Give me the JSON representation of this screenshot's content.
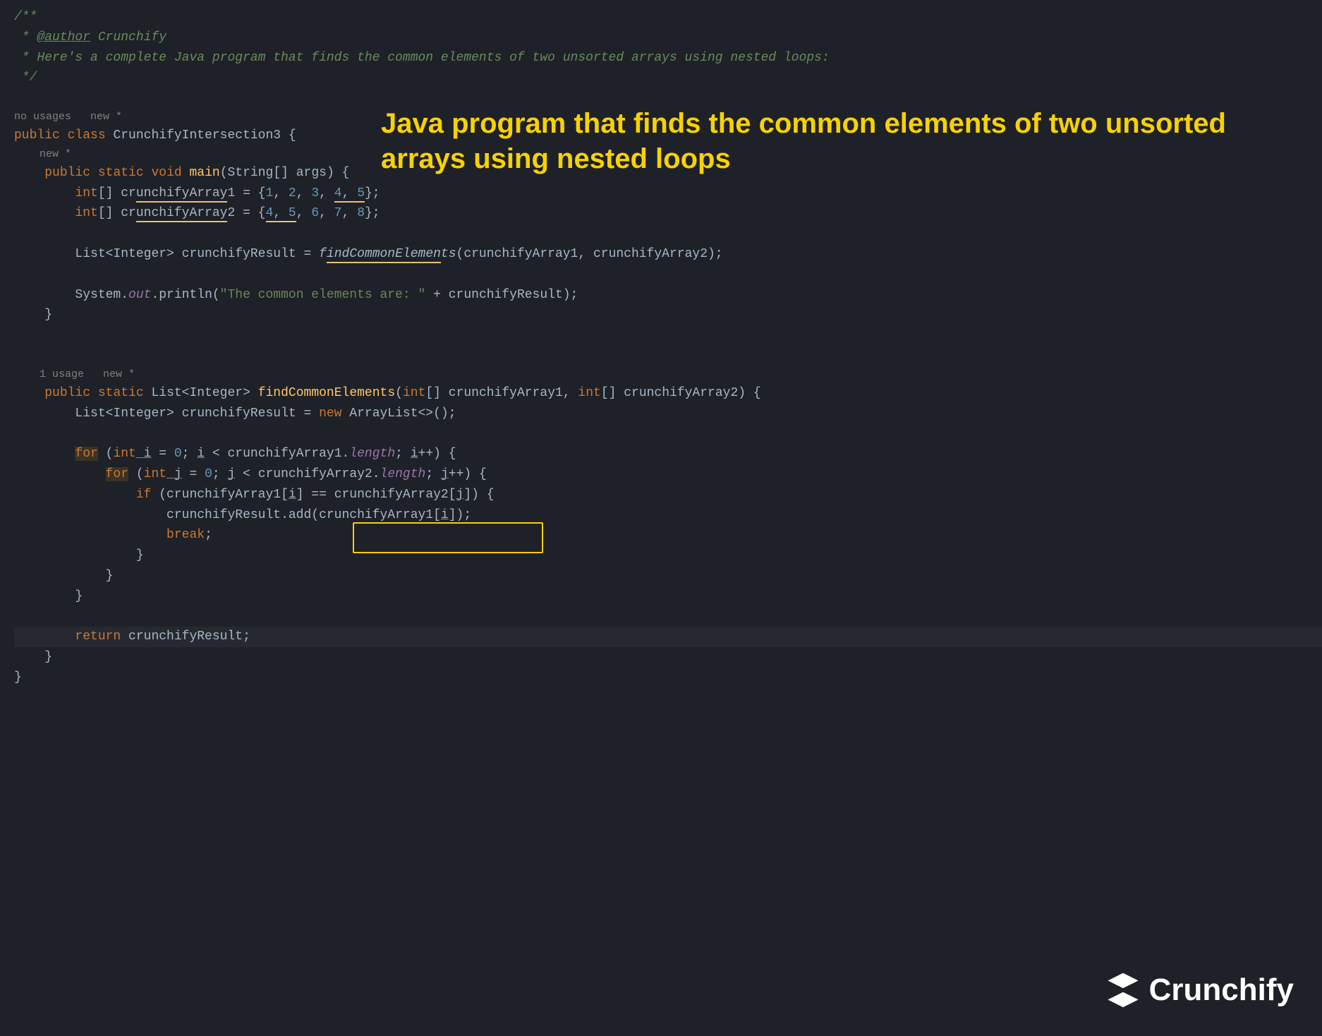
{
  "overlay_title": "Java program that finds the common elements of two unsorted arrays using nested loops",
  "logo_text": "Crunchify",
  "annotations": {
    "class": "no usages   new *",
    "main": "new *",
    "find": "1 usage   new *"
  },
  "code": {
    "c1": "/**",
    "c2_pre": " * ",
    "c2_tag": "@author",
    "c2_post": " Crunchify",
    "c3": " * Here's a complete Java program that finds the common elements of two unsorted arrays using nested loops:",
    "c4": " */",
    "k_public": "public",
    "k_class": "class",
    "class_name": "CrunchifyIntersection3",
    "k_static": "static",
    "k_void": "void",
    "m_main": "main",
    "p_main": "(String[] args) {",
    "t_int_arr": "int",
    "brackets": "[] ",
    "arr1_name": "crunchifyArray1",
    "arr1_init_pre": " = {",
    "arr1_vals_a": "1",
    "arr1_vals_b": "2",
    "arr1_vals_c": "3",
    "arr1_vals_d": "4",
    "arr1_vals_e": "5",
    "arr1_close": "};",
    "arr2_name": "crunchifyArray2",
    "arr2_vals_a": "4",
    "arr2_vals_b": "5",
    "arr2_vals_c": "6",
    "arr2_vals_d": "7",
    "arr2_vals_e": "8",
    "t_list": "List<Integer> crunchifyResult = ",
    "m_find_call": "findCommonElements",
    "call_args": "(crunchifyArray1, crunchifyArray2);",
    "sys": "System.",
    "out": "out",
    "println_pre": ".println(",
    "str_lit": "\"The common elements are: \"",
    "println_post": " + crunchifyResult);",
    "brace_close": "}",
    "ret_type": "List<Integer> ",
    "m_find": "findCommonElements",
    "find_params_pre": "(",
    "find_p1_type": "int",
    "find_p1_name": "[] crunchifyArray1, ",
    "find_p2_type": "int",
    "find_p2_name": "[] crunchifyArray2) {",
    "result_decl_pre": "List<Integer> crunchifyResult = ",
    "k_new": "new",
    "result_decl_post": " ArrayList<>();",
    "k_for": "for",
    "for1_pre": " (",
    "for1_int": "int",
    "for1_i": " i",
    "for1_eq": " = ",
    "for1_zero": "0",
    "for1_mid": "; ",
    "for1_cond_i": "i",
    "for1_cond": " < crunchifyArray1.",
    "for1_len": "length",
    "for1_inc_pre": "; ",
    "for1_inc_i": "i",
    "for1_inc": "++) {",
    "for2_j": " j",
    "for2_cond_j": "j",
    "for2_cond": " < crunchifyArray2.",
    "for2_inc_j": "j",
    "k_if": "if",
    "if_pre": " (crunchifyArray1[",
    "if_i": "i",
    "if_mid": "] == crunchifyArray2[",
    "if_j": "j",
    "if_post": "]) {",
    "add_pre": "crunchifyResult.add(crunchifyArray1[",
    "add_i": "i",
    "add_post": "]);",
    "k_break": "break",
    "semi": ";",
    "k_return": "return",
    "ret_val": " crunchifyResult;"
  }
}
